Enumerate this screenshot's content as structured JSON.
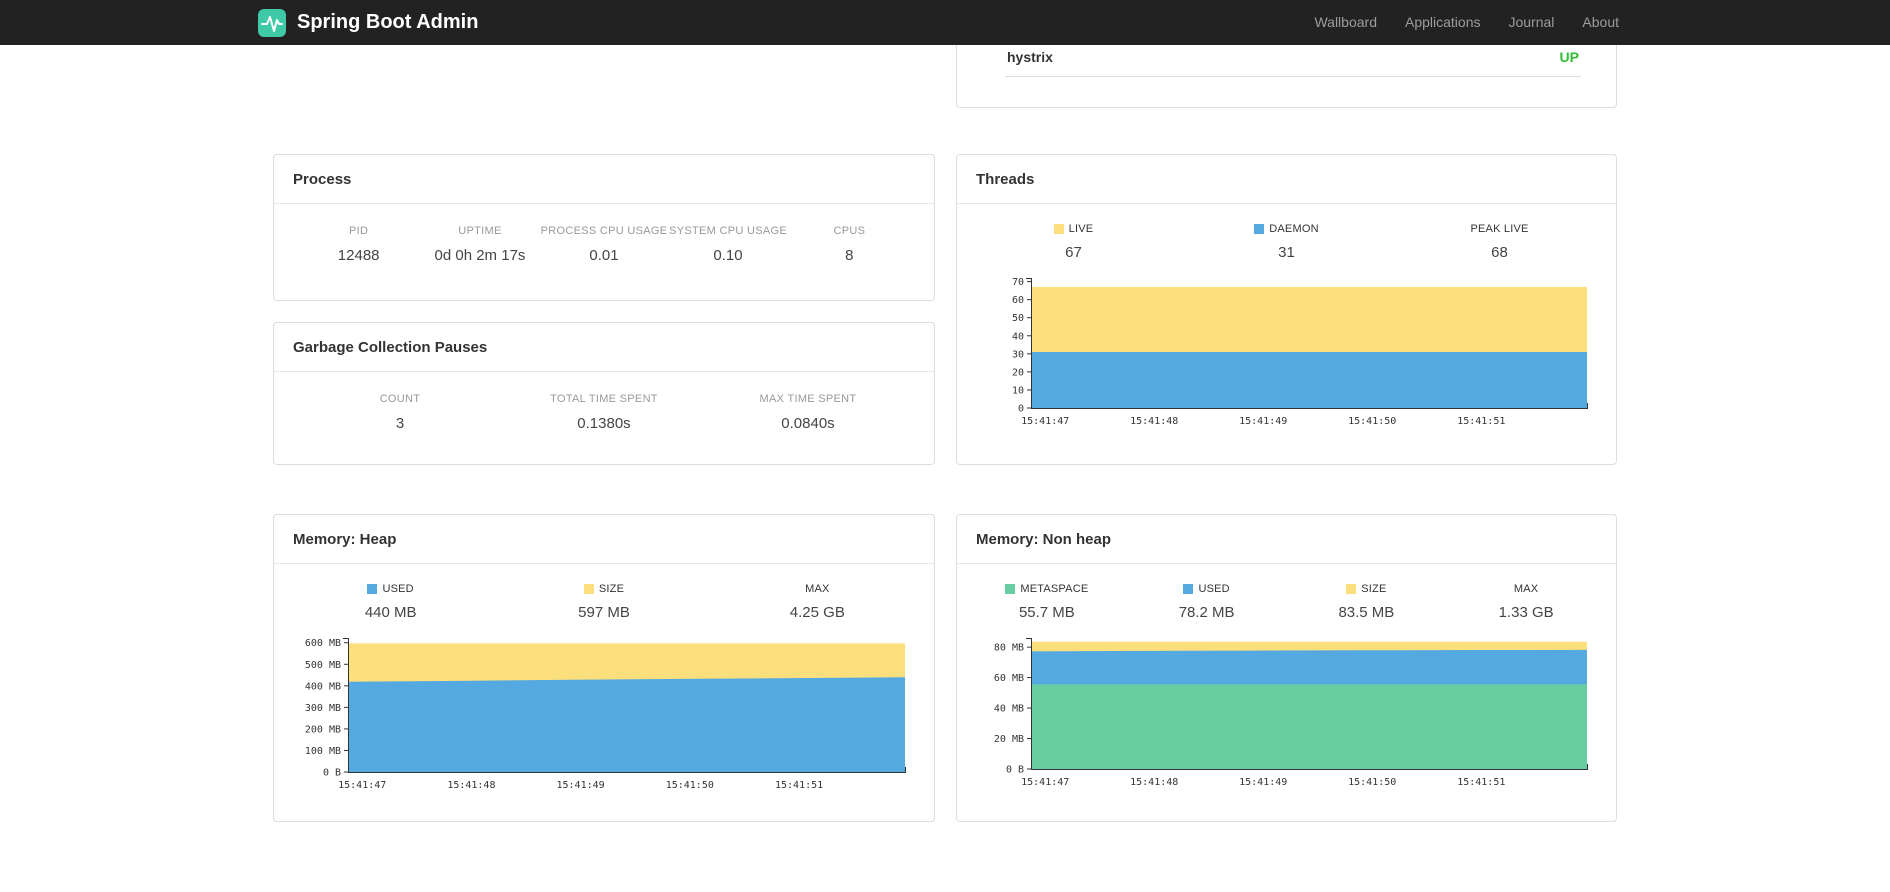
{
  "navbar": {
    "brand": "Spring Boot Admin",
    "items": [
      {
        "label": "Wallboard"
      },
      {
        "label": "Applications"
      },
      {
        "label": "Journal"
      },
      {
        "label": "About"
      }
    ]
  },
  "health": {
    "name": "hystrix",
    "status": "UP",
    "status_color": "#32BE32"
  },
  "colors": {
    "yellow": "#FBDF7C",
    "blue": "#54A9E0",
    "green": "#68CEA2",
    "navbar_bg": "#222222"
  },
  "cards": {
    "process": {
      "title": "Process",
      "metrics": [
        {
          "label": "PID",
          "value": "12488"
        },
        {
          "label": "UPTIME",
          "value": "0d 0h 2m 17s"
        },
        {
          "label": "PROCESS CPU USAGE",
          "value": "0.01"
        },
        {
          "label": "SYSTEM CPU USAGE",
          "value": "0.10"
        },
        {
          "label": "CPUS",
          "value": "8"
        }
      ]
    },
    "gc": {
      "title": "Garbage Collection Pauses",
      "metrics": [
        {
          "label": "COUNT",
          "value": "3"
        },
        {
          "label": "TOTAL TIME SPENT",
          "value": "0.1380s"
        },
        {
          "label": "MAX TIME SPENT",
          "value": "0.0840s"
        }
      ]
    },
    "threads": {
      "title": "Threads",
      "legend": [
        {
          "label": "LIVE",
          "value": "67",
          "swatch": "#FBDF7C"
        },
        {
          "label": "DAEMON",
          "value": "31",
          "swatch": "#54A9E0"
        },
        {
          "label": "PEAK LIVE",
          "value": "68"
        }
      ]
    },
    "heap": {
      "title": "Memory: Heap",
      "legend": [
        {
          "label": "USED",
          "value": "440 MB",
          "swatch": "#54A9E0"
        },
        {
          "label": "SIZE",
          "value": "597 MB",
          "swatch": "#FBDF7C"
        },
        {
          "label": "MAX",
          "value": "4.25 GB"
        }
      ]
    },
    "nonheap": {
      "title": "Memory: Non heap",
      "legend": [
        {
          "label": "METASPACE",
          "value": "55.7 MB",
          "swatch": "#68CEA2"
        },
        {
          "label": "USED",
          "value": "78.2 MB",
          "swatch": "#54A9E0"
        },
        {
          "label": "SIZE",
          "value": "83.5 MB",
          "swatch": "#FBDF7C"
        },
        {
          "label": "MAX",
          "value": "1.33 GB"
        }
      ]
    }
  },
  "chart_data": [
    {
      "id": "threads",
      "type": "area",
      "title": "Threads",
      "x_labels": [
        "15:41:47",
        "15:41:48",
        "15:41:49",
        "15:41:50",
        "15:41:51"
      ],
      "x_total": 5.1,
      "x_offset": 0.13,
      "ylim": [
        0,
        72
      ],
      "yticks": [
        {
          "v": 70,
          "label": "70"
        },
        {
          "v": 60,
          "label": "60"
        },
        {
          "v": 50,
          "label": "50"
        },
        {
          "v": 40,
          "label": "40"
        },
        {
          "v": 30,
          "label": "30"
        },
        {
          "v": 20,
          "label": "20"
        },
        {
          "v": 10,
          "label": "10"
        },
        {
          "v": 0,
          "label": "0"
        }
      ],
      "series": [
        {
          "name": "LIVE",
          "color": "#FBDF7C",
          "values": [
            67,
            67,
            67,
            67,
            67,
            67
          ]
        },
        {
          "name": "DAEMON",
          "color": "#54A9E0",
          "values": [
            31,
            31,
            31,
            31,
            31,
            31
          ]
        }
      ]
    },
    {
      "id": "heap",
      "type": "area",
      "title": "Memory: Heap",
      "x_labels": [
        "15:41:47",
        "15:41:48",
        "15:41:49",
        "15:41:50",
        "15:41:51"
      ],
      "x_total": 5.1,
      "x_offset": 0.13,
      "ylim": [
        0,
        622
      ],
      "yticks": [
        {
          "v": 600,
          "label": "600 MB"
        },
        {
          "v": 500,
          "label": "500 MB"
        },
        {
          "v": 400,
          "label": "400 MB"
        },
        {
          "v": 300,
          "label": "300 MB"
        },
        {
          "v": 200,
          "label": "200 MB"
        },
        {
          "v": 100,
          "label": "100 MB"
        },
        {
          "v": 0,
          "label": "0 B"
        }
      ],
      "series": [
        {
          "name": "SIZE",
          "color": "#FBDF7C",
          "values": [
            597,
            597,
            597,
            597,
            597,
            597
          ]
        },
        {
          "name": "USED",
          "color": "#54A9E0",
          "values": [
            419,
            423,
            428,
            432,
            436,
            440
          ]
        }
      ]
    },
    {
      "id": "nonheap",
      "type": "area",
      "title": "Memory: Non heap",
      "x_labels": [
        "15:41:47",
        "15:41:48",
        "15:41:49",
        "15:41:50",
        "15:41:51"
      ],
      "x_total": 5.1,
      "x_offset": 0.13,
      "ylim": [
        0,
        86
      ],
      "yticks": [
        {
          "v": 80,
          "label": "80 MB"
        },
        {
          "v": 60,
          "label": "60 MB"
        },
        {
          "v": 40,
          "label": "40 MB"
        },
        {
          "v": 20,
          "label": "20 MB"
        },
        {
          "v": 0,
          "label": "0 B"
        }
      ],
      "series": [
        {
          "name": "SIZE",
          "color": "#FBDF7C",
          "values": [
            83.5,
            83.5,
            83.5,
            83.5,
            83.5,
            83.5
          ]
        },
        {
          "name": "USED",
          "color": "#54A9E0",
          "values": [
            77.2,
            77.5,
            77.7,
            77.9,
            78.1,
            78.2
          ]
        },
        {
          "name": "METASPACE",
          "color": "#68CEA2",
          "values": [
            55.7,
            55.7,
            55.7,
            55.7,
            55.7,
            55.7
          ]
        }
      ]
    }
  ]
}
